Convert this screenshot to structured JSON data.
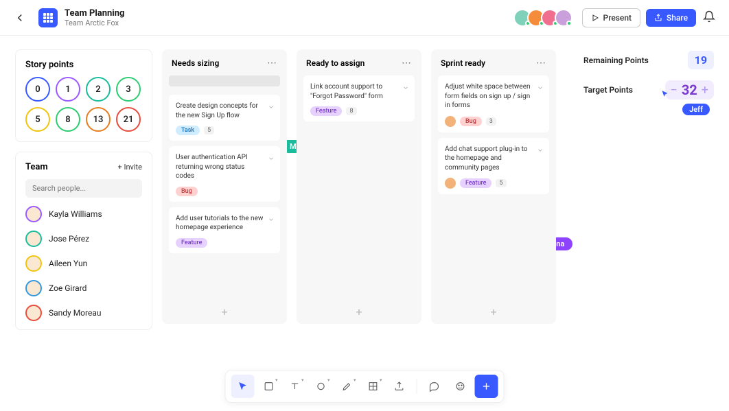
{
  "header": {
    "title": "Team Planning",
    "subtitle": "Team Arctic Fox",
    "present": "Present",
    "share": "Share"
  },
  "avatars": [
    {
      "bg": "#7fd1b9"
    },
    {
      "bg": "#f48c3b"
    },
    {
      "bg": "#f06f8e"
    },
    {
      "bg": "#c9a0dc"
    }
  ],
  "storyPoints": {
    "heading": "Story points",
    "values": [
      "0",
      "1",
      "2",
      "3",
      "5",
      "8",
      "13",
      "21"
    ],
    "colors": [
      "#3859ff",
      "#9b59ff",
      "#1abc9c",
      "#2ecc71",
      "#f1c40f",
      "#2ecc71",
      "#e67e22",
      "#e74c3c"
    ]
  },
  "team": {
    "heading": "Team",
    "invite": "+ Invite",
    "searchPlaceholder": "Search people...",
    "members": [
      {
        "name": "Kayla Williams",
        "color": "#9b59ff"
      },
      {
        "name": "Jose Pérez",
        "color": "#1abc9c"
      },
      {
        "name": "Aileen Yun",
        "color": "#f1c40f"
      },
      {
        "name": "Zoe Girard",
        "color": "#3498db"
      },
      {
        "name": "Sandy Moreau",
        "color": "#e74c3c"
      }
    ]
  },
  "columns": [
    {
      "title": "Needs sizing",
      "placeholder": true,
      "cards": [
        {
          "title": "Create design concepts for the new Sign Up flow",
          "tag": "Task",
          "tagClass": "tag-task",
          "count": "5"
        },
        {
          "title": "User authentication API returning wrong status codes",
          "tag": "Bug",
          "tagClass": "tag-bug"
        },
        {
          "title": "Add user tutorials to the new homepage experience",
          "tag": "Feature",
          "tagClass": "tag-feature"
        }
      ]
    },
    {
      "title": "Ready to assign",
      "cards": [
        {
          "title": "Link account support to \"Forgot Password\" form",
          "tag": "Feature",
          "tagClass": "tag-feature",
          "count": "8"
        }
      ]
    },
    {
      "title": "Sprint ready",
      "cards": [
        {
          "title": "Adjust white space between form fields on sign up / sign in forms",
          "tag": "Bug",
          "tagClass": "tag-bug",
          "count": "3",
          "avatar": true
        },
        {
          "title": "Add chat support plug-in to the homepage and community pages",
          "tag": "Feature",
          "tagClass": "tag-feature",
          "count": "5",
          "avatar": true
        }
      ]
    }
  ],
  "metrics": {
    "remainingLabel": "Remaining Points",
    "remainingValue": "19",
    "targetLabel": "Target Points",
    "targetValue": "32",
    "jeff": "Jeff"
  },
  "cursors": {
    "mona": "Mona",
    "yana": "Yana"
  }
}
